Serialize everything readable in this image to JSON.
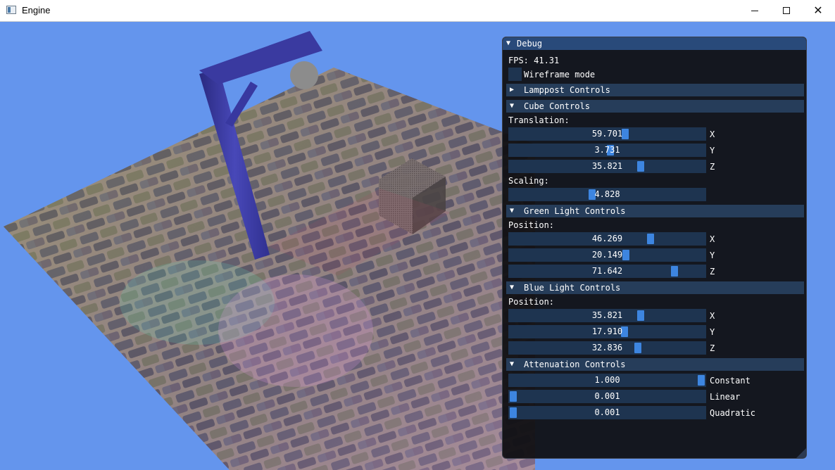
{
  "window": {
    "title": "Engine"
  },
  "debug": {
    "title": "Debug",
    "fps_label": "FPS: 41.31",
    "wireframe_label": "Wireframe mode",
    "wireframe_checked": false,
    "sections": {
      "lamppost": {
        "label": "Lamppost Controls",
        "expanded": false
      },
      "cube": {
        "label": "Cube Controls",
        "expanded": true,
        "translation_label": "Translation:",
        "translation": [
          {
            "value": "59.701",
            "axis": "X",
            "fill": 0.597
          },
          {
            "value": "3.731",
            "axis": "Y",
            "fill": 0.517
          },
          {
            "value": "35.821",
            "axis": "Z",
            "fill": 0.679
          }
        ],
        "scaling_label": "Scaling:",
        "scaling": {
          "value": "4.828",
          "fill": 0.418
        }
      },
      "green_light": {
        "label": "Green Light Controls",
        "position_label": "Position:",
        "position": [
          {
            "value": "46.269",
            "axis": "X",
            "fill": 0.731
          },
          {
            "value": "20.149",
            "axis": "Y",
            "fill": 0.601
          },
          {
            "value": "71.642",
            "axis": "Z",
            "fill": 0.858
          }
        ]
      },
      "blue_light": {
        "label": "Blue Light Controls",
        "position_label": "Position:",
        "position": [
          {
            "value": "35.821",
            "axis": "X",
            "fill": 0.679
          },
          {
            "value": "17.910",
            "axis": "Y",
            "fill": 0.59
          },
          {
            "value": "32.836",
            "axis": "Z",
            "fill": 0.664
          }
        ]
      },
      "attenuation": {
        "label": "Attenuation Controls",
        "params": [
          {
            "value": "1.000",
            "label": "Constant",
            "fill": 1.0
          },
          {
            "value": "0.001",
            "label": "Linear",
            "fill": 0.0
          },
          {
            "value": "0.001",
            "label": "Quadratic",
            "fill": 0.0
          }
        ]
      }
    }
  },
  "colors": {
    "background": "#6495ed",
    "panel_bg": "#0f0f12",
    "header": "#263d5a",
    "slider_bg": "#1e3450",
    "slider_grab": "#3d85e0"
  }
}
